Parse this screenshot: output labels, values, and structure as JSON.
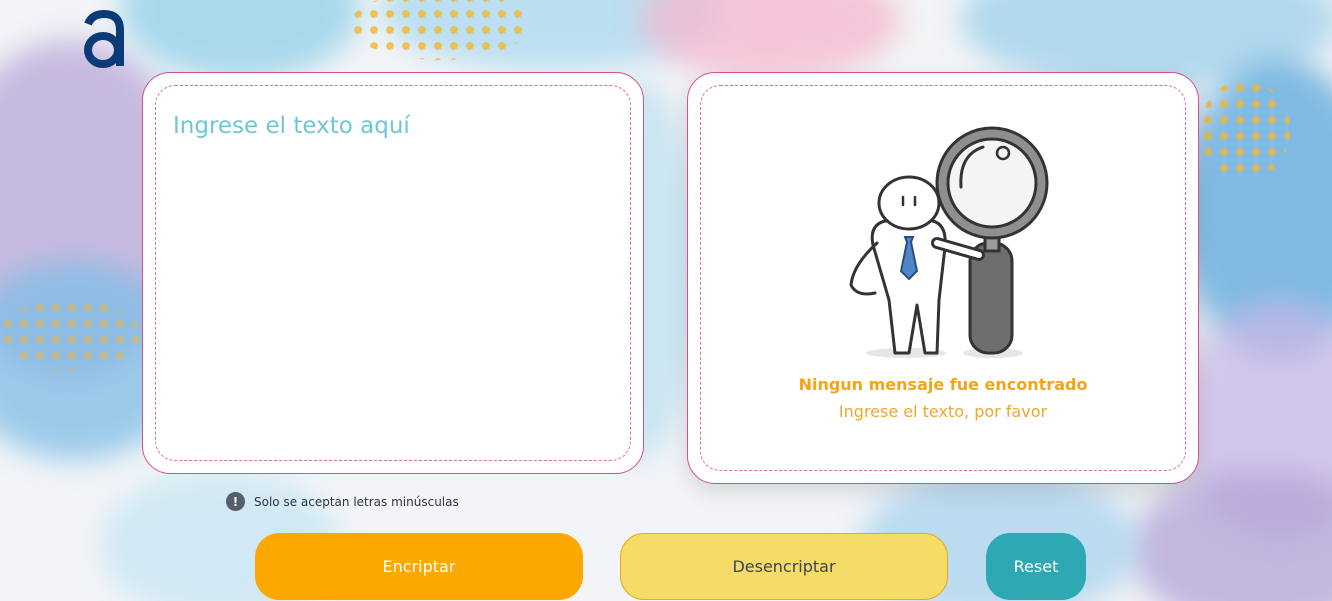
{
  "app": {
    "logo_icon": "alura-logo",
    "accent_color": "#d64f8f"
  },
  "input": {
    "placeholder": "Ingrese el texto aquí",
    "value": ""
  },
  "output": {
    "illustration": "person-with-magnifier",
    "title": "Ningun mensaje fue encontrado",
    "subtitle": "Ingrese el texto, por favor"
  },
  "hint": {
    "icon": "exclamation-circle-icon",
    "text": "Solo se aceptan letras minúsculas"
  },
  "buttons": {
    "encrypt": "Encriptar",
    "decrypt": "Desencriptar",
    "reset": "Reset"
  }
}
